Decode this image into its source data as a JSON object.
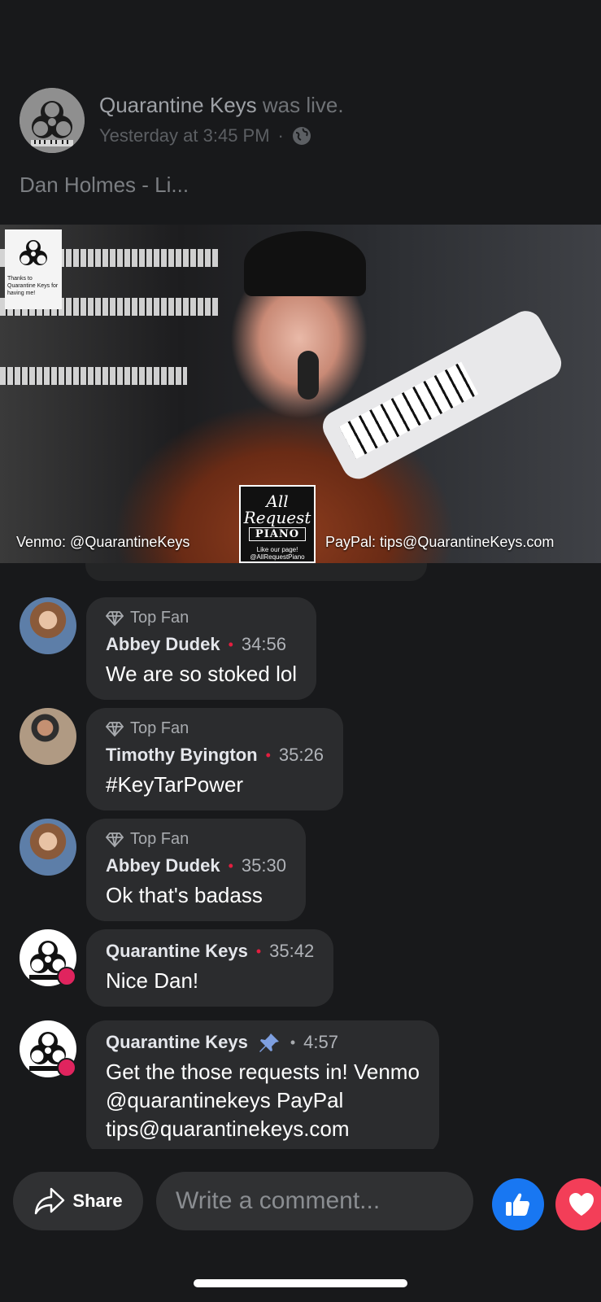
{
  "post": {
    "page_name": "Quarantine Keys",
    "status_text": "was live.",
    "timestamp": "Yesterday at 3:45 PM",
    "separator": "·",
    "privacy_icon": "globe-icon",
    "title": "Dan Holmes - Li..."
  },
  "video": {
    "overlay_logo_text": "Thanks to Quarantine Keys for having me!",
    "arp_logo": {
      "line1": "All",
      "line2": "Request",
      "line3": "PIANO",
      "line4": "Like our page! @AllRequestPiano"
    },
    "venmo_caption": "Venmo: @QuarantineKeys",
    "paypal_caption": "PayPal: tips@QuarantineKeys.com"
  },
  "comments": [
    {
      "badge": "Top Fan",
      "author": "Abbey Dudek",
      "time": "34:56",
      "text": "We are so stoked lol"
    },
    {
      "badge": "Top Fan",
      "author": "Timothy Byington",
      "time": "35:26",
      "text": "#KeyTarPower"
    },
    {
      "badge": "Top Fan",
      "author": "Abbey Dudek",
      "time": "35:30",
      "text": "Ok that's badass"
    },
    {
      "author": "Quarantine Keys",
      "time": "35:42",
      "text": "Nice Dan!"
    },
    {
      "author": "Quarantine Keys",
      "time": "4:57",
      "text_lines": [
        "Get the those requests in! Venmo",
        "@quarantinekeys PayPal",
        "tips@quarantinekeys.com"
      ]
    }
  ],
  "footer": {
    "share_label": "Share",
    "comment_placeholder": "Write a comment..."
  },
  "colors": {
    "background": "#18191b",
    "bubble": "#2b2c2e",
    "like_blue": "#1877f2",
    "love_red": "#f33e58",
    "dot_red": "#e41e3f",
    "pin_blue": "#7e9fe0"
  }
}
